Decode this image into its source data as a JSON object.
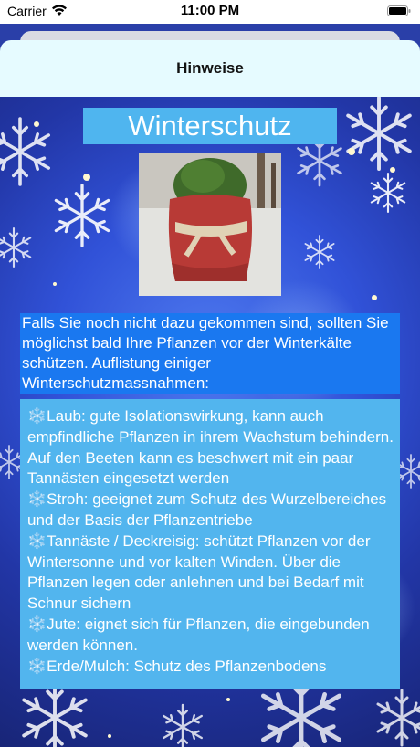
{
  "status_bar": {
    "carrier": "Carrier",
    "time": "11:00 PM"
  },
  "sheet": {
    "title": "Hinweise"
  },
  "content": {
    "heading": "Winterschutz",
    "intro": "Falls Sie noch nicht dazu gekommen sind, sollten Sie möglichst bald Ihre Pflanzen vor der Winterkälte schützen. Auflistung einiger Winterschutzmassnahmen:",
    "items": [
      {
        "icon": "snowflake-icon",
        "text": "Laub: gute Isolationswirkung, kann auch empfindliche Pflanzen in ihrem Wachstum behindern. Auf den Beeten kann es beschwert mit ein paar Tannästen eingesetzt werden"
      },
      {
        "icon": "snowflake-icon",
        "text": "Stroh: geeignet zum  Schutz des Wurzelbereiches und der Basis der Pflanzentriebe"
      },
      {
        "icon": "snowflake-icon",
        "text": "Tannäste / Deckreisig: schützt Pflanzen vor der Wintersonne und vor kalten Winden. Über die Pflanzen legen oder anlehnen und bei Bedarf mit Schnur sichern"
      },
      {
        "icon": "snowflake-icon",
        "text": "Jute:  eignet sich für Pflanzen, die eingebunden werden können."
      },
      {
        "icon": "snowflake-icon",
        "text": "Erde/Mulch: Schutz des Pflanzenbodens"
      }
    ]
  },
  "colors": {
    "title_box": "#4fb5ef",
    "intro_box": "#1a78f0",
    "list_box": "#52b5ee"
  }
}
